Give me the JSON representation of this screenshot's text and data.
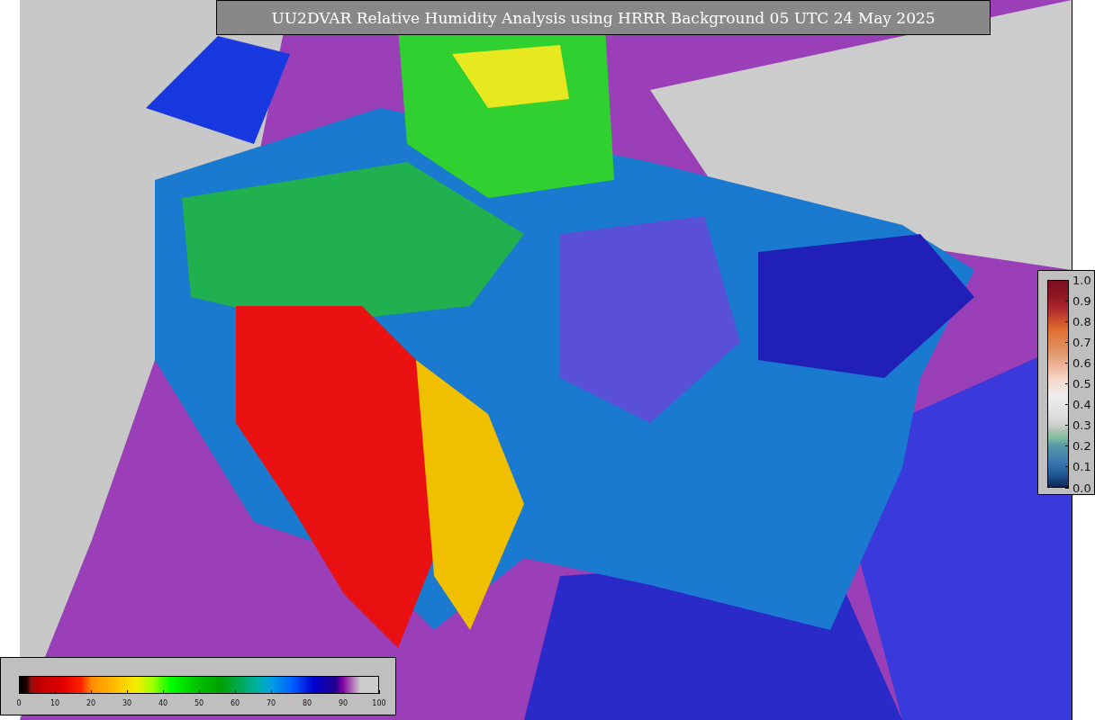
{
  "title": "UU2DVAR Relative Humidity Analysis using HRRR Background 05 UTC 24 May 2025",
  "rh_colorbar": {
    "ticks": [
      "0",
      "10",
      "20",
      "30",
      "40",
      "50",
      "60",
      "70",
      "80",
      "90",
      "100"
    ]
  },
  "ratio_colorbar": {
    "ticks": [
      "1.0",
      "0.9",
      "0.8",
      "0.7",
      "0.6",
      "0.5",
      "0.4",
      "0.3",
      "0.2",
      "0.1",
      "0.0"
    ]
  }
}
